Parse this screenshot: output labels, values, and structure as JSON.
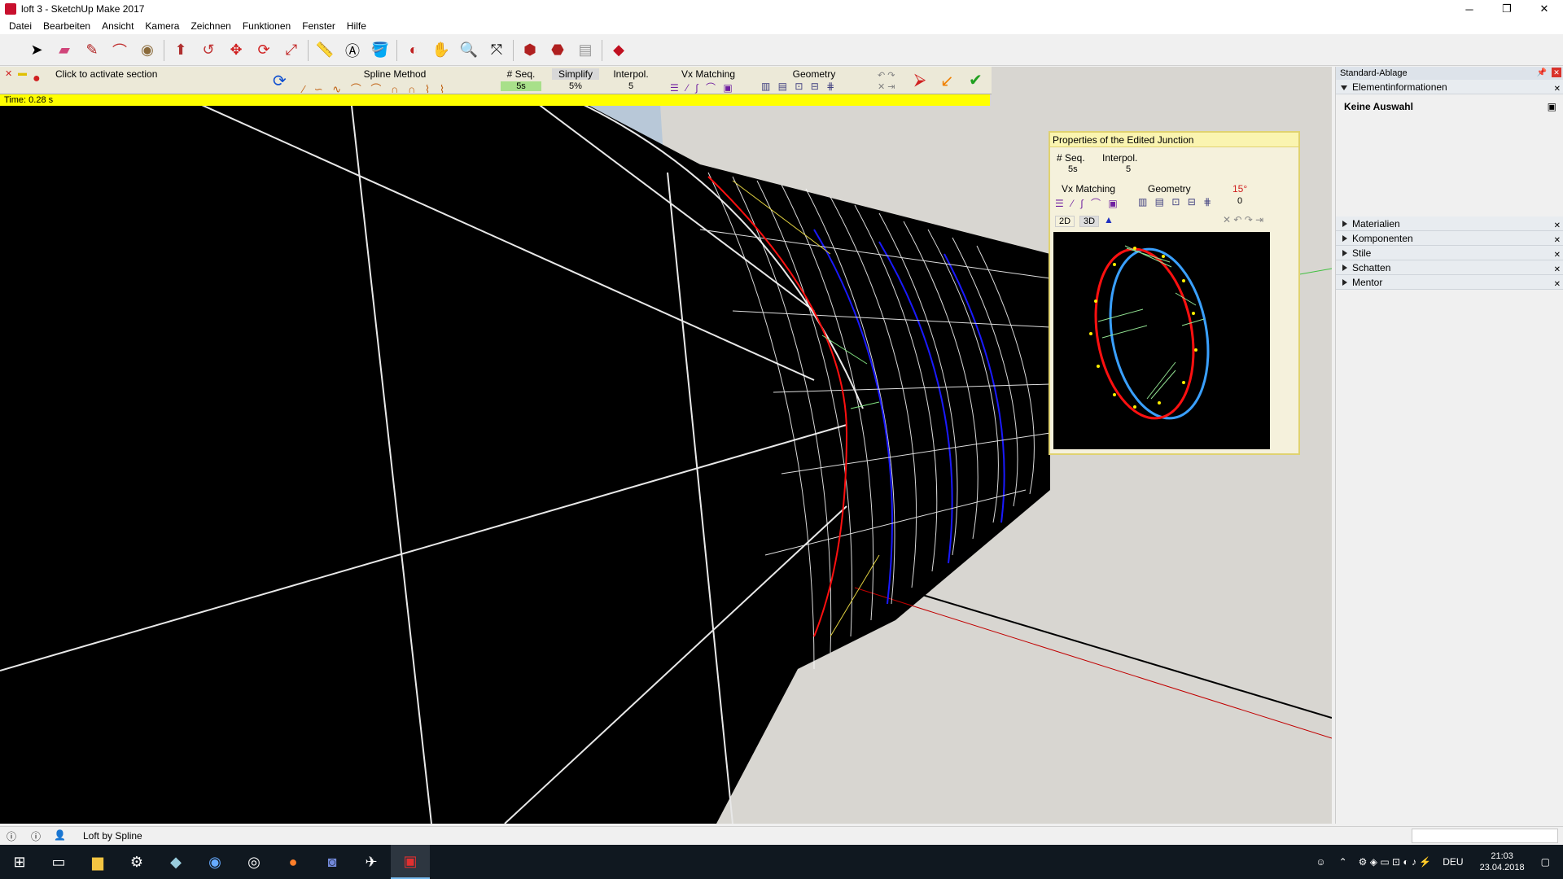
{
  "window": {
    "title": "loft 3 - SketchUp Make 2017",
    "controls": [
      "─",
      "❐",
      "✕"
    ]
  },
  "menu": [
    "Datei",
    "Bearbeiten",
    "Ansicht",
    "Kamera",
    "Zeichnen",
    "Funktionen",
    "Fenster",
    "Hilfe"
  ],
  "loft_toolbar": {
    "activate_text": "Click to activate section",
    "spline_method_label": "Spline Method",
    "seq_label": "# Seq.",
    "seq_value": "5s",
    "simplify_label": "Simplify",
    "simplify_value": "5%",
    "interpol_label": "Interpol.",
    "interpol_value": "5",
    "vx_matching_label": "Vx Matching",
    "geometry_label": "Geometry"
  },
  "time_text": "Time: 0.28 s",
  "junction_panel": {
    "title": "Properties of the Edited Junction",
    "seq_label": "# Seq.",
    "seq_value": "5s",
    "interpol_label": "Interpol.",
    "interpol_value": "5",
    "vx_matching_label": "Vx Matching",
    "geometry_label": "Geometry",
    "angle_label": "15°",
    "angle_value": "0",
    "tab_2d": "2D",
    "tab_3d": "3D"
  },
  "tray": {
    "header": "Standard-Ablage",
    "entity_info_title": "Elementinformationen",
    "entity_info_value": "Keine Auswahl",
    "sections": [
      "Materialien",
      "Komponenten",
      "Stile",
      "Schatten",
      "Mentor"
    ]
  },
  "status": {
    "message": "Loft by Spline"
  },
  "taskbar": {
    "lang": "DEU",
    "time": "21:03",
    "date": "23.04.2018"
  }
}
